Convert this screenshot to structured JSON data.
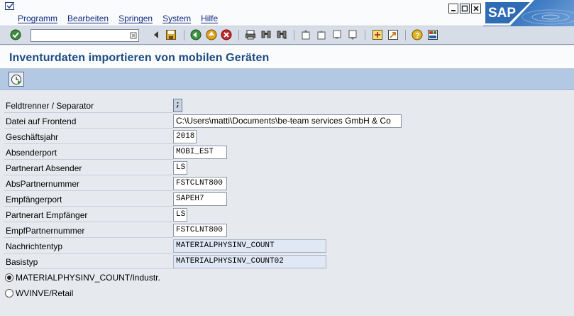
{
  "menubar": {
    "items": [
      "Programm",
      "Bearbeiten",
      "Springen",
      "System",
      "Hilfe"
    ],
    "logo_text": "SAP"
  },
  "toolbar": {
    "command_field_value": ""
  },
  "title": "Inventurdaten importieren von mobilen Geräten",
  "form": {
    "fields": [
      {
        "label": "Feldtrenner / Separator",
        "value": ";"
      },
      {
        "label": "Datei auf Frontend",
        "value": "C:\\Users\\matti\\Documents\\be-team services GmbH & Co"
      },
      {
        "label": "Geschäftsjahr",
        "value": "2018"
      },
      {
        "label": "Absenderport",
        "value": "MOBI_EST"
      },
      {
        "label": "Partnerart Absender",
        "value": "LS"
      },
      {
        "label": "AbsPartnernummer",
        "value": "FSTCLNT800"
      },
      {
        "label": "Empfängerport",
        "value": "SAPEH7"
      },
      {
        "label": "Partnerart Empfänger",
        "value": "LS"
      },
      {
        "label": "EmpfPartnernummer",
        "value": "FSTCLNT800"
      },
      {
        "label": "Nachrichtentyp",
        "value": "MATERIALPHYSINV_COUNT"
      },
      {
        "label": "Basistyp",
        "value": "MATERIALPHYSINV_COUNT02"
      }
    ],
    "radios": [
      {
        "label": "MATERIALPHYSINV_COUNT/Industr.",
        "selected": true
      },
      {
        "label": "WVINVE/Retail",
        "selected": false
      }
    ]
  },
  "colors": {
    "title": "#1c4b82",
    "app_toolbar": "#b3c9e3",
    "background": "#e6e9ee"
  }
}
